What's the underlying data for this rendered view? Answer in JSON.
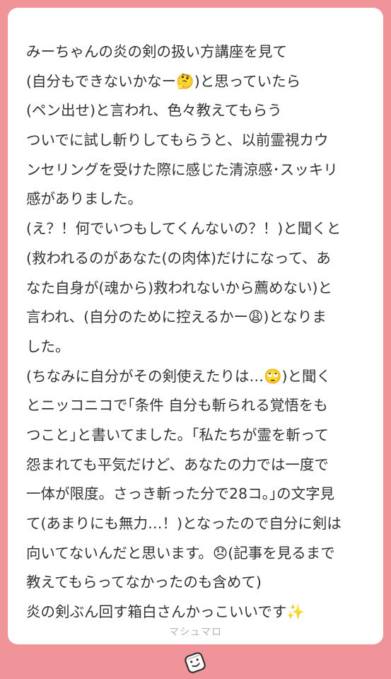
{
  "message": {
    "lines": [
      "みーちゃんの炎の剣の扱い方講座を見て",
      "(自分もできないかなー🤔)と思っていたら",
      "(ペン出せ)と言われ、色々教えてもらう",
      "ついでに試し斬りしてもらうと、以前霊視カウ",
      "ンセリングを受けた際に感じた清涼感･スッキリ",
      "感がありました。",
      "(え？！何でいつもしてくんないの？！)と聞くと",
      "(救われるのがあなた(の肉体)だけになって、あ",
      "なた自身が(魂から)救われないから薦めない)と",
      "言われ、(自分のために控えるかー😩)となりま",
      "した。",
      "(ちなみに自分がその剣使えたりは…🙄)と聞く",
      "とニッコニコで｢条件 自分も斬られる覚悟をも",
      "つこと｣と書いてました。｢私たちが霊を斬って",
      "怨まれても平気だけど、あなたの力では一度で",
      "一体が限度。さっき斬った分で28コ。｣の文字見",
      "て(あまりにも無力…！)となったので自分に剣は",
      "向いてないんだと思います。😞(記事を見るまで",
      "教えてもらってなかったのも含めて)",
      "炎の剣ぶん回す箱白さんかっこいいです✨"
    ]
  },
  "footer": {
    "brand": "マシュマロ"
  },
  "colors": {
    "background": "#f1949a",
    "card": "#ffffff",
    "text": "#333333",
    "brand": "#b4b4b4"
  },
  "icons": {
    "logo": "marshmallow-logo-icon"
  }
}
